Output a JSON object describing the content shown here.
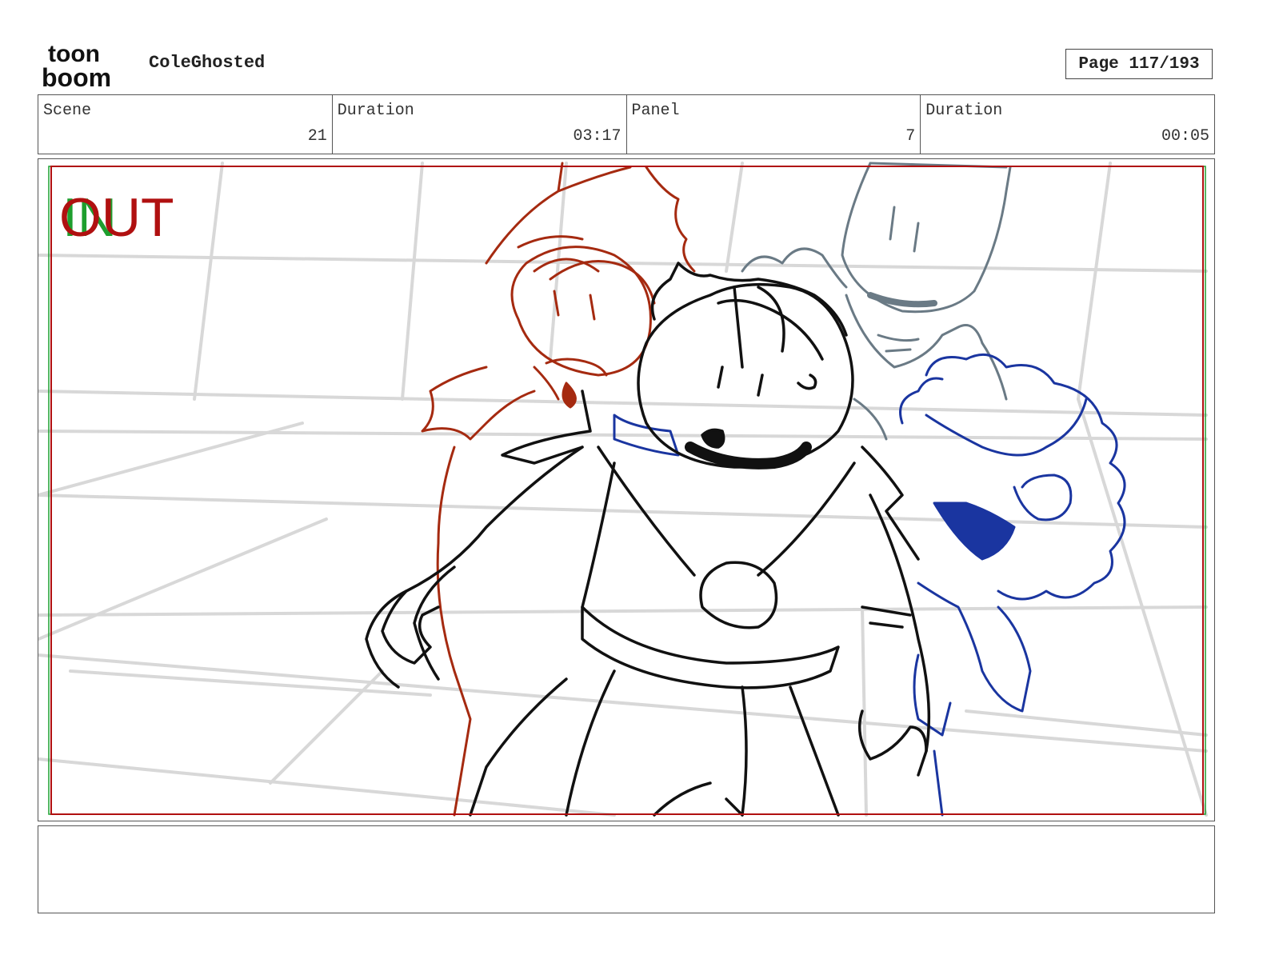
{
  "header": {
    "logo_text_top": "toon",
    "logo_text_bottom": "boom",
    "project_title": "ColeGhosted",
    "page_label": "Page 117/193"
  },
  "info": {
    "scene_label": "Scene",
    "scene_value": "21",
    "scene_duration_label": "Duration",
    "scene_duration_value": "03:17",
    "panel_label": "Panel",
    "panel_value": "7",
    "panel_duration_label": "Duration",
    "panel_duration_value": "00:05"
  },
  "panel": {
    "in_marker": "IN",
    "out_marker": "OUT",
    "colors": {
      "in_marker": "#1e9e2e",
      "out_marker": "#b01010",
      "frame_red": "#b01010",
      "frame_green": "#1e9e2e",
      "sketch_black": "#111111",
      "sketch_red": "#a52a10",
      "sketch_blue": "#1a35a0",
      "sketch_gray": "#6a7a85",
      "grid_gray": "#d8d8d8"
    }
  },
  "notes": {
    "text": ""
  }
}
